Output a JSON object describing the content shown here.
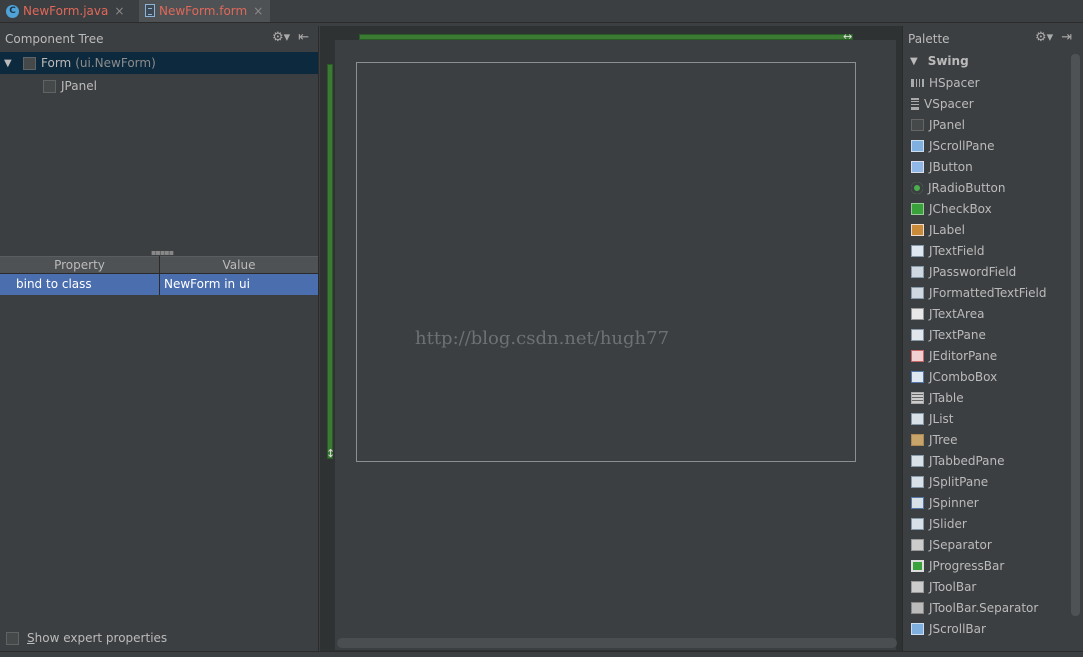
{
  "tabs": [
    {
      "label": "NewForm.java",
      "icon": "java-class-icon",
      "close": "×"
    },
    {
      "label": "NewForm.form",
      "icon": "form-file-icon",
      "close": "×"
    }
  ],
  "component_tree": {
    "title": "Component Tree",
    "items": [
      {
        "label": "Form",
        "sub": "(ui.NewForm)",
        "expanded": true,
        "selected": true
      },
      {
        "label": "JPanel",
        "sub": ""
      }
    ]
  },
  "properties": {
    "col_property": "Property",
    "col_value": "Value",
    "rows": [
      {
        "property": "bind to class",
        "value": "NewForm in ui"
      }
    ],
    "expert_label_s": "S",
    "expert_label_rest": "how expert properties"
  },
  "design": {
    "watermark": "http://blog.csdn.net/hugh77",
    "colors": {
      "guide": "#3a7a33",
      "selection": "#4b6eaf"
    }
  },
  "palette": {
    "title": "Palette",
    "group": "Swing",
    "items": [
      {
        "label": "HSpacer",
        "icon": "hspacer-icon"
      },
      {
        "label": "VSpacer",
        "icon": "vspacer-icon"
      },
      {
        "label": "JPanel",
        "icon": "panel-icon"
      },
      {
        "label": "JScrollPane",
        "icon": "scrollpane-icon"
      },
      {
        "label": "JButton",
        "icon": "button-icon"
      },
      {
        "label": "JRadioButton",
        "icon": "radio-icon"
      },
      {
        "label": "JCheckBox",
        "icon": "checkbox-icon"
      },
      {
        "label": "JLabel",
        "icon": "label-icon"
      },
      {
        "label": "JTextField",
        "icon": "textfield-icon"
      },
      {
        "label": "JPasswordField",
        "icon": "password-icon"
      },
      {
        "label": "JFormattedTextField",
        "icon": "formatted-icon"
      },
      {
        "label": "JTextArea",
        "icon": "textarea-icon"
      },
      {
        "label": "JTextPane",
        "icon": "textpane-icon"
      },
      {
        "label": "JEditorPane",
        "icon": "editorpane-icon"
      },
      {
        "label": "JComboBox",
        "icon": "combobox-icon"
      },
      {
        "label": "JTable",
        "icon": "table-icon"
      },
      {
        "label": "JList",
        "icon": "list-icon"
      },
      {
        "label": "JTree",
        "icon": "tree-icon"
      },
      {
        "label": "JTabbedPane",
        "icon": "tabbedpane-icon"
      },
      {
        "label": "JSplitPane",
        "icon": "splitpane-icon"
      },
      {
        "label": "JSpinner",
        "icon": "spinner-icon"
      },
      {
        "label": "JSlider",
        "icon": "slider-icon"
      },
      {
        "label": "JSeparator",
        "icon": "separator-icon"
      },
      {
        "label": "JProgressBar",
        "icon": "progressbar-icon"
      },
      {
        "label": "JToolBar",
        "icon": "toolbar-icon"
      },
      {
        "label": "JToolBar.Separator",
        "icon": "toolbar-separator-icon"
      },
      {
        "label": "JScrollBar",
        "icon": "scrollbar-icon"
      }
    ]
  }
}
